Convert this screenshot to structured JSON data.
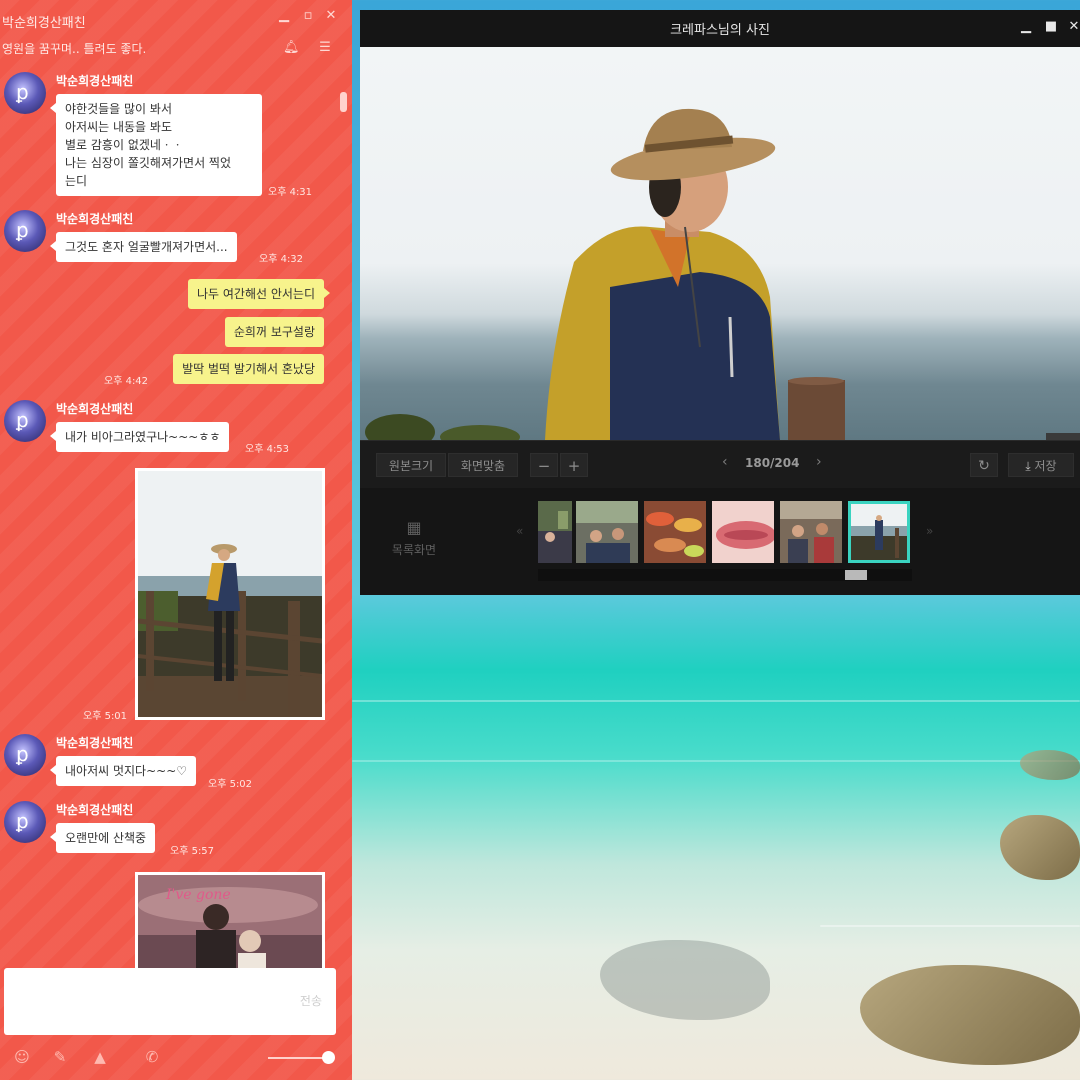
{
  "chat": {
    "title": "박순희경산패친",
    "status_message": "영원을 꿈꾸며.. 틀려도 좋다.",
    "send_label": "전송",
    "messages": [
      {
        "sender": "박순희경산패친",
        "text": "야한것들을 많이 봐서\n아저씨는 내동을 봐도\n별로 감흥이 없겠네ㆍㆍ\n나는 심장이 쫄깃해져가면서 찍었\n는디",
        "time": "오후 4:31"
      },
      {
        "sender": "박순희경산패친",
        "text": "그것도 혼자 얼굴빨개져가면서...",
        "time": "오후 4:32"
      },
      {
        "text": "나두 여간해선 안서는디"
      },
      {
        "text": "순희꺼 보구설랑"
      },
      {
        "text": "발딱 벌떡 발기해서 혼났당",
        "time": "오후 4:42"
      },
      {
        "sender": "박순희경산패친",
        "text": "내가 비아그라였구나~~~ㅎㅎ",
        "time": "오후 4:53"
      },
      {
        "time": "오후 5:01"
      },
      {
        "sender": "박순희경산패친",
        "text": "내아저씨 멋지다~~~♡",
        "time": "오후 5:02"
      },
      {
        "sender": "박순희경산패친",
        "text": "오랜만에 산책중",
        "time": "오후 5:57"
      }
    ],
    "photo_caption": "I've gone"
  },
  "viewer": {
    "title": "크레파스님의 사진",
    "btn_original": "원본크기",
    "btn_fit": "화면맞춤",
    "zoom_out": "−",
    "zoom_in": "+",
    "pager": "180/204",
    "save_label": "저장",
    "list_view_label": "목록화면"
  },
  "colors": {
    "chat_bg": "#f2584a",
    "out_bubble": "#f7f38c",
    "selected_thumb": "#3ad3c0"
  }
}
